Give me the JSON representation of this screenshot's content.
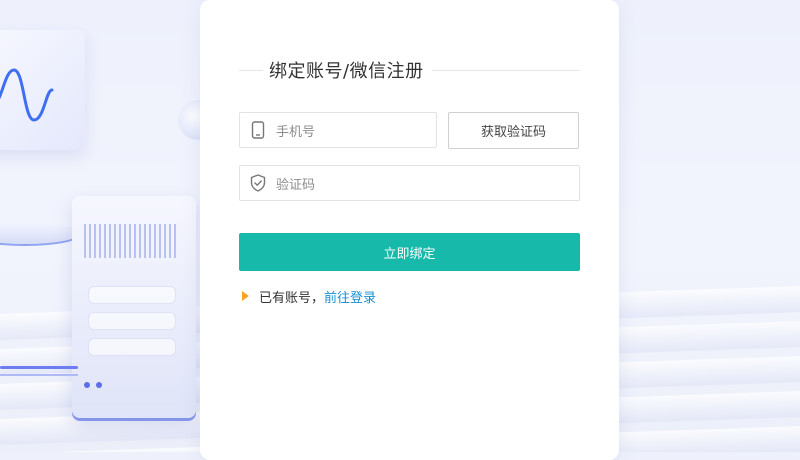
{
  "page": {
    "title": "绑定账号/微信注册"
  },
  "form": {
    "phone_placeholder": "手机号",
    "get_code_label": "获取验证码",
    "code_placeholder": "验证码",
    "submit_label": "立即绑定"
  },
  "footer": {
    "prompt": "已有账号，",
    "login_link": "前往登录"
  },
  "icons": {
    "phone": "phone-icon",
    "shield": "shield-check-icon",
    "arrow": "triangle-right-icon"
  },
  "colors": {
    "primary": "#16b9aa",
    "link": "#1a8fd4",
    "arrow": "#f5a623"
  }
}
